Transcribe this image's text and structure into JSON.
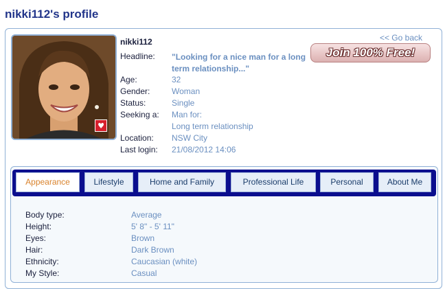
{
  "page": {
    "title": "nikki112's profile"
  },
  "profile": {
    "username": "nikki112",
    "fields": [
      {
        "label": "Headline:",
        "value": "\"Looking for a nice man for a long term relationship...\""
      },
      {
        "label": "Age:",
        "value": "32"
      },
      {
        "label": "Gender:",
        "value": "Woman"
      },
      {
        "label": "Status:",
        "value": "Single"
      },
      {
        "label": "Seeking a:",
        "value": "Man for:",
        "value2": "Long term relationship"
      },
      {
        "label": "Location:",
        "value": "NSW City"
      },
      {
        "label": "Last login:",
        "value": "21/08/2012 14:06"
      }
    ]
  },
  "actions": {
    "go_back": "<< Go back",
    "join": "Join 100% Free!"
  },
  "tabs": [
    {
      "label": "Appearance",
      "active": true
    },
    {
      "label": "Lifestyle"
    },
    {
      "label": "Home and Family"
    },
    {
      "label": "Professional Life"
    },
    {
      "label": "Personal"
    },
    {
      "label": "About Me"
    }
  ],
  "appearance": [
    {
      "label": "Body type:",
      "value": "Average"
    },
    {
      "label": "Height:",
      "value": "5' 8\" - 5' 11\""
    },
    {
      "label": "Eyes:",
      "value": "Brown"
    },
    {
      "label": "Hair:",
      "value": "Dark Brown"
    },
    {
      "label": "Ethnicity:",
      "value": "Caucasian (white)"
    },
    {
      "label": "My Style:",
      "value": "Casual"
    }
  ],
  "colors": {
    "title": "#22358a",
    "value": "#6a8fc0",
    "tab_bar": "#0b0e8e",
    "active_tab": "#d9822b"
  }
}
